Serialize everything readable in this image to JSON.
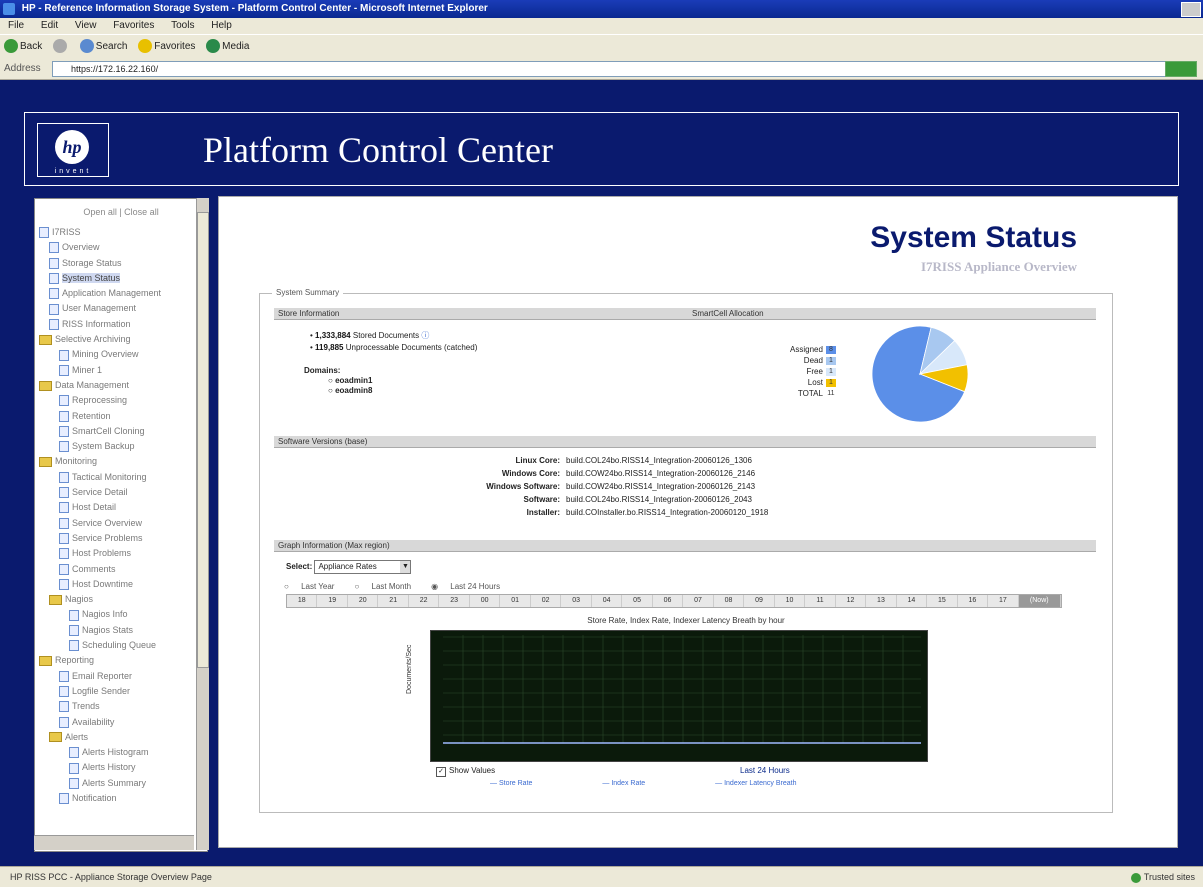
{
  "browser": {
    "title": "HP - Reference Information Storage System - Platform Control Center - Microsoft Internet Explorer",
    "menus": [
      "File",
      "Edit",
      "View",
      "Favorites",
      "Tools",
      "Help"
    ],
    "toolbar": {
      "back": "Back",
      "search": "Search",
      "favorites": "Favorites",
      "media": "Media"
    },
    "address_label": "Address",
    "address_value": "https://172.16.22.160/",
    "status_left": "HP RISS PCC - Appliance Storage Overview Page",
    "status_right": "Trusted sites"
  },
  "header": {
    "logo_text": "hp",
    "logo_sub": "invent",
    "title": "Platform Control Center"
  },
  "nav": {
    "tools": "Open all | Close all",
    "items": [
      {
        "label": "I7RISS",
        "type": "root",
        "depth": 0
      },
      {
        "label": "Overview",
        "type": "page",
        "depth": 1
      },
      {
        "label": "Storage Status",
        "type": "page",
        "depth": 1
      },
      {
        "label": "System Status",
        "type": "page",
        "depth": 1,
        "selected": true
      },
      {
        "label": "Application Management",
        "type": "page",
        "depth": 1
      },
      {
        "label": "User Management",
        "type": "page",
        "depth": 1
      },
      {
        "label": "RISS Information",
        "type": "page",
        "depth": 1
      },
      {
        "label": "Selective Archiving",
        "type": "folder",
        "depth": 0
      },
      {
        "label": "Mining Overview",
        "type": "page",
        "depth": 2
      },
      {
        "label": "Miner 1",
        "type": "page",
        "depth": 2
      },
      {
        "label": "Data Management",
        "type": "folder",
        "depth": 0
      },
      {
        "label": "Reprocessing",
        "type": "page",
        "depth": 2
      },
      {
        "label": "Retention",
        "type": "page",
        "depth": 2
      },
      {
        "label": "SmartCell Cloning",
        "type": "page",
        "depth": 2
      },
      {
        "label": "System Backup",
        "type": "page",
        "depth": 2
      },
      {
        "label": "Monitoring",
        "type": "folder",
        "depth": 0
      },
      {
        "label": "Tactical Monitoring",
        "type": "page",
        "depth": 2
      },
      {
        "label": "Service Detail",
        "type": "page",
        "depth": 2
      },
      {
        "label": "Host Detail",
        "type": "page",
        "depth": 2
      },
      {
        "label": "Service Overview",
        "type": "page",
        "depth": 2
      },
      {
        "label": "Service Problems",
        "type": "page",
        "depth": 2
      },
      {
        "label": "Host Problems",
        "type": "page",
        "depth": 2
      },
      {
        "label": "Comments",
        "type": "page",
        "depth": 2
      },
      {
        "label": "Host Downtime",
        "type": "page",
        "depth": 2
      },
      {
        "label": "Nagios",
        "type": "folder",
        "depth": 1
      },
      {
        "label": "Nagios Info",
        "type": "page",
        "depth": 3
      },
      {
        "label": "Nagios Stats",
        "type": "page",
        "depth": 3
      },
      {
        "label": "Scheduling Queue",
        "type": "page",
        "depth": 3
      },
      {
        "label": "Reporting",
        "type": "folder",
        "depth": 0
      },
      {
        "label": "Email Reporter",
        "type": "page",
        "depth": 2
      },
      {
        "label": "Logfile Sender",
        "type": "page",
        "depth": 2
      },
      {
        "label": "Trends",
        "type": "page",
        "depth": 2
      },
      {
        "label": "Availability",
        "type": "page",
        "depth": 2
      },
      {
        "label": "Alerts",
        "type": "folder",
        "depth": 1
      },
      {
        "label": "Alerts Histogram",
        "type": "page",
        "depth": 3
      },
      {
        "label": "Alerts History",
        "type": "page",
        "depth": 3
      },
      {
        "label": "Alerts Summary",
        "type": "page",
        "depth": 3
      },
      {
        "label": "Notification",
        "type": "page",
        "depth": 2
      }
    ]
  },
  "main": {
    "title": "System Status",
    "subtitle": "I7RISS Appliance Overview",
    "summary_legend": "System Summary",
    "store_header": "Store Information",
    "smartcell_header": "SmartCell Allocation",
    "store_items": [
      {
        "count": "1,333,884",
        "label": "Stored Documents"
      },
      {
        "count": "119,885",
        "label": "Unprocessable Documents (catched)"
      }
    ],
    "domains_label": "Domains:",
    "domains": [
      "eoadmin1",
      "eoadmin8"
    ],
    "smartcell_legend": [
      {
        "label": "Assigned",
        "value": "8",
        "color": "#5b8fe8"
      },
      {
        "label": "Dead",
        "value": "1",
        "color": "#a8c8f0"
      },
      {
        "label": "Free",
        "value": "1",
        "color": "#d8e8fa"
      },
      {
        "label": "Lost",
        "value": "1",
        "color": "#f2c000"
      },
      {
        "label": "TOTAL",
        "value": "11",
        "color": null
      }
    ],
    "software_header": "Software Versions (base)",
    "software": [
      {
        "key": "Linux Core:",
        "value": "build.COL24bo.RISS14_Integration-20060126_1306"
      },
      {
        "key": "Windows Core:",
        "value": "build.COW24bo.RISS14_Integration-20060126_2146"
      },
      {
        "key": "Windows Software:",
        "value": "build.COW24bo.RISS14_Integration-20060126_2143"
      },
      {
        "key": "Software:",
        "value": "build.COL24bo.RISS14_Integration-20060126_2043"
      },
      {
        "key": "Installer:",
        "value": "build.COInstaller.bo.RISS14_Integration-20060120_1918"
      }
    ],
    "graph_header": "Graph Information (Max region)",
    "select_label": "Select:",
    "select_value": "Appliance Rates",
    "radios": [
      {
        "label": "Last Year",
        "checked": false
      },
      {
        "label": "Last Month",
        "checked": false
      },
      {
        "label": "Last 24 Hours",
        "checked": true
      }
    ],
    "hours": [
      "18",
      "19",
      "20",
      "21",
      "22",
      "23",
      "00",
      "01",
      "02",
      "03",
      "04",
      "05",
      "06",
      "07",
      "08",
      "09",
      "10",
      "11",
      "12",
      "13",
      "14",
      "15",
      "16",
      "17"
    ],
    "hours_now": "(Now)",
    "graph_title": "Store Rate, Index Rate, Indexer Latency Breath by hour",
    "y_label": "Documents/Sec",
    "show_values": "Show Values",
    "last_label": "Last 24 Hours",
    "graph_legend": [
      "Store Rate",
      "Index Rate",
      "Indexer Latency Breath"
    ]
  },
  "chart_data": {
    "type": "pie",
    "title": "SmartCell Allocation",
    "labels": [
      "Assigned",
      "Dead",
      "Free",
      "Lost"
    ],
    "values": [
      8,
      1,
      1,
      1
    ],
    "colors": [
      "#5b8fe8",
      "#a8c8f0",
      "#d8e8fa",
      "#f2c000"
    ],
    "total": 11
  }
}
